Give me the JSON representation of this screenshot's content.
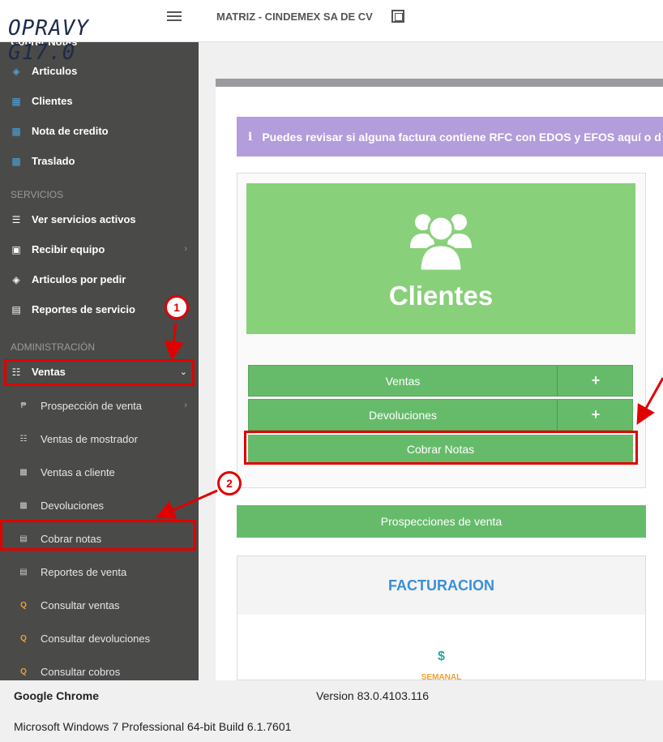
{
  "header": {
    "logo": "OPRAVY G17.0",
    "company": "MATRIZ - CINDEMEX SA DE CV"
  },
  "sidebar": {
    "partial_item": "Cobrar Notas",
    "items_top": [
      {
        "label": "Articulos",
        "icon": "tags-icon"
      },
      {
        "label": "Clientes",
        "icon": "address-book-icon"
      },
      {
        "label": "Nota de credito",
        "icon": "document-icon"
      },
      {
        "label": "Traslado",
        "icon": "document-icon"
      }
    ],
    "section_servicios": "SERVICIOS",
    "items_servicios": [
      {
        "label": "Ver servicios activos",
        "icon": "list-icon"
      },
      {
        "label": "Recibir equipo",
        "icon": "truck-icon"
      },
      {
        "label": "Articulos por pedir",
        "icon": "tags-icon"
      },
      {
        "label": "Reportes de servicio",
        "icon": "bar-chart-icon"
      }
    ],
    "section_admin": "ADMINISTRACIÓN",
    "ventas_label": "Ventas",
    "ventas_sub": [
      {
        "label": "Prospección de venta",
        "icon": "peso-icon"
      },
      {
        "label": "Ventas de mostrador",
        "icon": "cart-icon"
      },
      {
        "label": "Ventas a cliente",
        "icon": "document-icon"
      },
      {
        "label": "Devoluciones",
        "icon": "document-icon"
      },
      {
        "label": "Cobrar notas",
        "icon": "money-icon"
      },
      {
        "label": "Reportes de venta",
        "icon": "bar-chart-icon"
      },
      {
        "label": "Consultar ventas",
        "icon": "search-icon"
      },
      {
        "label": "Consultar devoluciones",
        "icon": "search-icon"
      },
      {
        "label": "Consultar cobros",
        "icon": "search-icon"
      }
    ]
  },
  "main": {
    "alert_icon": "i",
    "alert_text": "Puedes revisar si alguna factura contiene RFC con EDOS y EFOS aquí o d",
    "clients_title": "Clientes",
    "btn_ventas": "Ventas",
    "btn_devoluciones": "Devoluciones",
    "plus": "+",
    "btn_cobrar": "Cobrar Notas",
    "btn_prospecciones": "Prospecciones de venta",
    "facturacion": "FACTURACION",
    "dollar": "$",
    "semanal": "SEMANAL"
  },
  "annotations": {
    "badge1": "1",
    "badge2": "2"
  },
  "footer": {
    "app": "Google Chrome",
    "version": "Version 83.0.4103.116",
    "os": "Microsoft Windows 7 Professional  64-bit Build 6.1.7601"
  },
  "colors": {
    "sidebar": "#4a4a48",
    "green": "#66bb6a",
    "header_green": "#88d07a",
    "alert": "#b39ddb",
    "annotation_red": "#e00000"
  }
}
